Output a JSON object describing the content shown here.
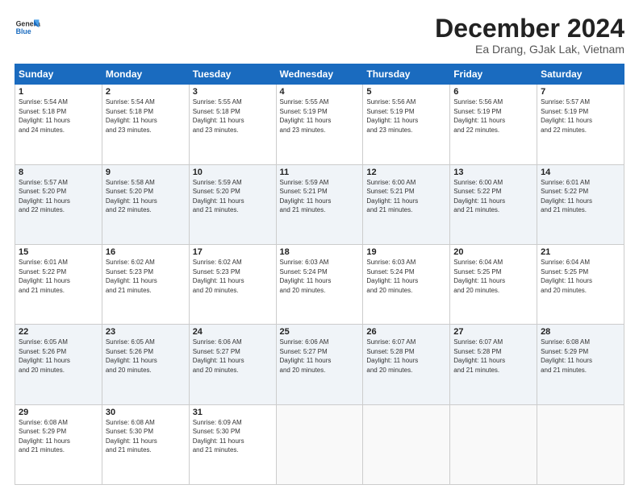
{
  "header": {
    "logo_line1": "General",
    "logo_line2": "Blue",
    "month": "December 2024",
    "location": "Ea Drang, GJak Lak, Vietnam"
  },
  "weekdays": [
    "Sunday",
    "Monday",
    "Tuesday",
    "Wednesday",
    "Thursday",
    "Friday",
    "Saturday"
  ],
  "weeks": [
    [
      {
        "day": "1",
        "info": "Sunrise: 5:54 AM\nSunset: 5:18 PM\nDaylight: 11 hours\nand 24 minutes."
      },
      {
        "day": "2",
        "info": "Sunrise: 5:54 AM\nSunset: 5:18 PM\nDaylight: 11 hours\nand 23 minutes."
      },
      {
        "day": "3",
        "info": "Sunrise: 5:55 AM\nSunset: 5:18 PM\nDaylight: 11 hours\nand 23 minutes."
      },
      {
        "day": "4",
        "info": "Sunrise: 5:55 AM\nSunset: 5:19 PM\nDaylight: 11 hours\nand 23 minutes."
      },
      {
        "day": "5",
        "info": "Sunrise: 5:56 AM\nSunset: 5:19 PM\nDaylight: 11 hours\nand 23 minutes."
      },
      {
        "day": "6",
        "info": "Sunrise: 5:56 AM\nSunset: 5:19 PM\nDaylight: 11 hours\nand 22 minutes."
      },
      {
        "day": "7",
        "info": "Sunrise: 5:57 AM\nSunset: 5:19 PM\nDaylight: 11 hours\nand 22 minutes."
      }
    ],
    [
      {
        "day": "8",
        "info": "Sunrise: 5:57 AM\nSunset: 5:20 PM\nDaylight: 11 hours\nand 22 minutes."
      },
      {
        "day": "9",
        "info": "Sunrise: 5:58 AM\nSunset: 5:20 PM\nDaylight: 11 hours\nand 22 minutes."
      },
      {
        "day": "10",
        "info": "Sunrise: 5:59 AM\nSunset: 5:20 PM\nDaylight: 11 hours\nand 21 minutes."
      },
      {
        "day": "11",
        "info": "Sunrise: 5:59 AM\nSunset: 5:21 PM\nDaylight: 11 hours\nand 21 minutes."
      },
      {
        "day": "12",
        "info": "Sunrise: 6:00 AM\nSunset: 5:21 PM\nDaylight: 11 hours\nand 21 minutes."
      },
      {
        "day": "13",
        "info": "Sunrise: 6:00 AM\nSunset: 5:22 PM\nDaylight: 11 hours\nand 21 minutes."
      },
      {
        "day": "14",
        "info": "Sunrise: 6:01 AM\nSunset: 5:22 PM\nDaylight: 11 hours\nand 21 minutes."
      }
    ],
    [
      {
        "day": "15",
        "info": "Sunrise: 6:01 AM\nSunset: 5:22 PM\nDaylight: 11 hours\nand 21 minutes."
      },
      {
        "day": "16",
        "info": "Sunrise: 6:02 AM\nSunset: 5:23 PM\nDaylight: 11 hours\nand 21 minutes."
      },
      {
        "day": "17",
        "info": "Sunrise: 6:02 AM\nSunset: 5:23 PM\nDaylight: 11 hours\nand 20 minutes."
      },
      {
        "day": "18",
        "info": "Sunrise: 6:03 AM\nSunset: 5:24 PM\nDaylight: 11 hours\nand 20 minutes."
      },
      {
        "day": "19",
        "info": "Sunrise: 6:03 AM\nSunset: 5:24 PM\nDaylight: 11 hours\nand 20 minutes."
      },
      {
        "day": "20",
        "info": "Sunrise: 6:04 AM\nSunset: 5:25 PM\nDaylight: 11 hours\nand 20 minutes."
      },
      {
        "day": "21",
        "info": "Sunrise: 6:04 AM\nSunset: 5:25 PM\nDaylight: 11 hours\nand 20 minutes."
      }
    ],
    [
      {
        "day": "22",
        "info": "Sunrise: 6:05 AM\nSunset: 5:26 PM\nDaylight: 11 hours\nand 20 minutes."
      },
      {
        "day": "23",
        "info": "Sunrise: 6:05 AM\nSunset: 5:26 PM\nDaylight: 11 hours\nand 20 minutes."
      },
      {
        "day": "24",
        "info": "Sunrise: 6:06 AM\nSunset: 5:27 PM\nDaylight: 11 hours\nand 20 minutes."
      },
      {
        "day": "25",
        "info": "Sunrise: 6:06 AM\nSunset: 5:27 PM\nDaylight: 11 hours\nand 20 minutes."
      },
      {
        "day": "26",
        "info": "Sunrise: 6:07 AM\nSunset: 5:28 PM\nDaylight: 11 hours\nand 20 minutes."
      },
      {
        "day": "27",
        "info": "Sunrise: 6:07 AM\nSunset: 5:28 PM\nDaylight: 11 hours\nand 21 minutes."
      },
      {
        "day": "28",
        "info": "Sunrise: 6:08 AM\nSunset: 5:29 PM\nDaylight: 11 hours\nand 21 minutes."
      }
    ],
    [
      {
        "day": "29",
        "info": "Sunrise: 6:08 AM\nSunset: 5:29 PM\nDaylight: 11 hours\nand 21 minutes."
      },
      {
        "day": "30",
        "info": "Sunrise: 6:08 AM\nSunset: 5:30 PM\nDaylight: 11 hours\nand 21 minutes."
      },
      {
        "day": "31",
        "info": "Sunrise: 6:09 AM\nSunset: 5:30 PM\nDaylight: 11 hours\nand 21 minutes."
      },
      null,
      null,
      null,
      null
    ]
  ]
}
